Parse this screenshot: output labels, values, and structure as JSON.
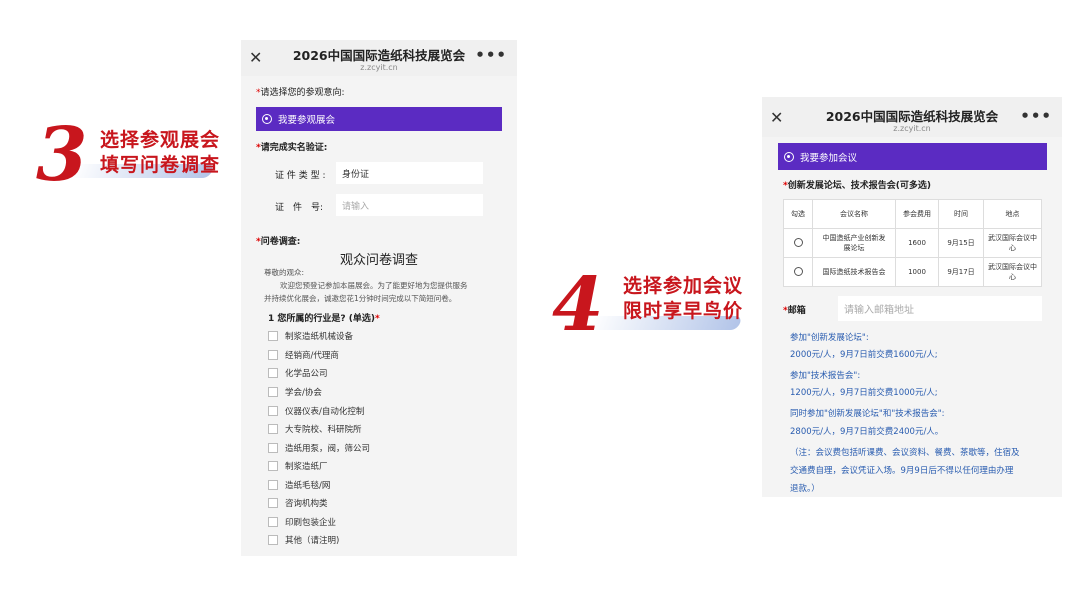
{
  "step3": {
    "number": "3",
    "line1": "选择参观展会",
    "line2": "填写问卷调查"
  },
  "step4": {
    "number": "4",
    "line1": "选择参加会议",
    "line2": "限时享早鸟价"
  },
  "phone1": {
    "title": "2026中国国际造纸科技展览会",
    "url": "z.zcyit.cn",
    "intent_label": "请选择您的参观意向:",
    "option_visit": "我要参观展会",
    "verify_label": "请完成实名验证:",
    "id_type_label": "证 件 类 型 :",
    "id_type_value": "身份证",
    "id_no_label": "证　件　号:",
    "id_no_placeholder": "请输入",
    "survey_label": "问卷调查:",
    "survey_title": "观众问卷调查",
    "greeting": "尊敬的观众:",
    "intro_line1": "欢迎您预登记参加本届展会。为了能更好地为您提供服务",
    "intro_line2": "并持续优化展会，诚邀您花1分钟时间完成以下简短问卷。",
    "q1": "1  您所属的行业是? (单选)",
    "industries": [
      "制浆造纸机械设备",
      "经销商/代理商",
      "化学品公司",
      "学会/协会",
      "仪器仪表/自动化控制",
      "大专院校、科研院所",
      "造纸用泵，阀，筛公司",
      "制浆造纸厂",
      "造纸毛毯/网",
      "咨询机构类",
      "印刷包装企业",
      "其他（请注明)"
    ]
  },
  "phone2": {
    "title": "2026中国国际造纸科技展览会",
    "url": "z.zcyit.cn",
    "option_meeting": "我要参加会议",
    "forum_label": "创新发展论坛、技术报告会(可多选)",
    "table": {
      "headers": [
        "勾选",
        "会议名称",
        "参会费用",
        "时间",
        "地点"
      ],
      "rows": [
        {
          "name_l1": "中国造纸产业创新发",
          "name_l2": "展论坛",
          "fee": "1600",
          "date": "9月15日",
          "place_l1": "武汉国际会议中",
          "place_l2": "心"
        },
        {
          "name_l1": "国际造纸技术报告会",
          "name_l2": "",
          "fee": "1000",
          "date": "9月17日",
          "place_l1": "武汉国际会议中",
          "place_l2": "心"
        }
      ]
    },
    "email_label": "邮箱",
    "email_placeholder": "请输入邮箱地址",
    "pricing": [
      "参加\"创新发展论坛\":",
      "2000元/人，9月7日前交费1600元/人;",
      "参加\"技术报告会\":",
      "1200元/人，9月7日前交费1000元/人;",
      "同时参加\"创新发展论坛\"和\"技术报告会\":",
      "2800元/人，9月7日前交费2400元/人。"
    ],
    "note_lines": [
      "（注：会议费包括听课费、会议资料、餐费、茶歇等，住宿及",
      "交通费自理，会议凭证入场。9月9日后不得以任何理由办理",
      "退款。）"
    ]
  },
  "colors": {
    "accent_red": "#c8161d",
    "purple": "#5b2bc2",
    "link_blue": "#2a5db0"
  }
}
